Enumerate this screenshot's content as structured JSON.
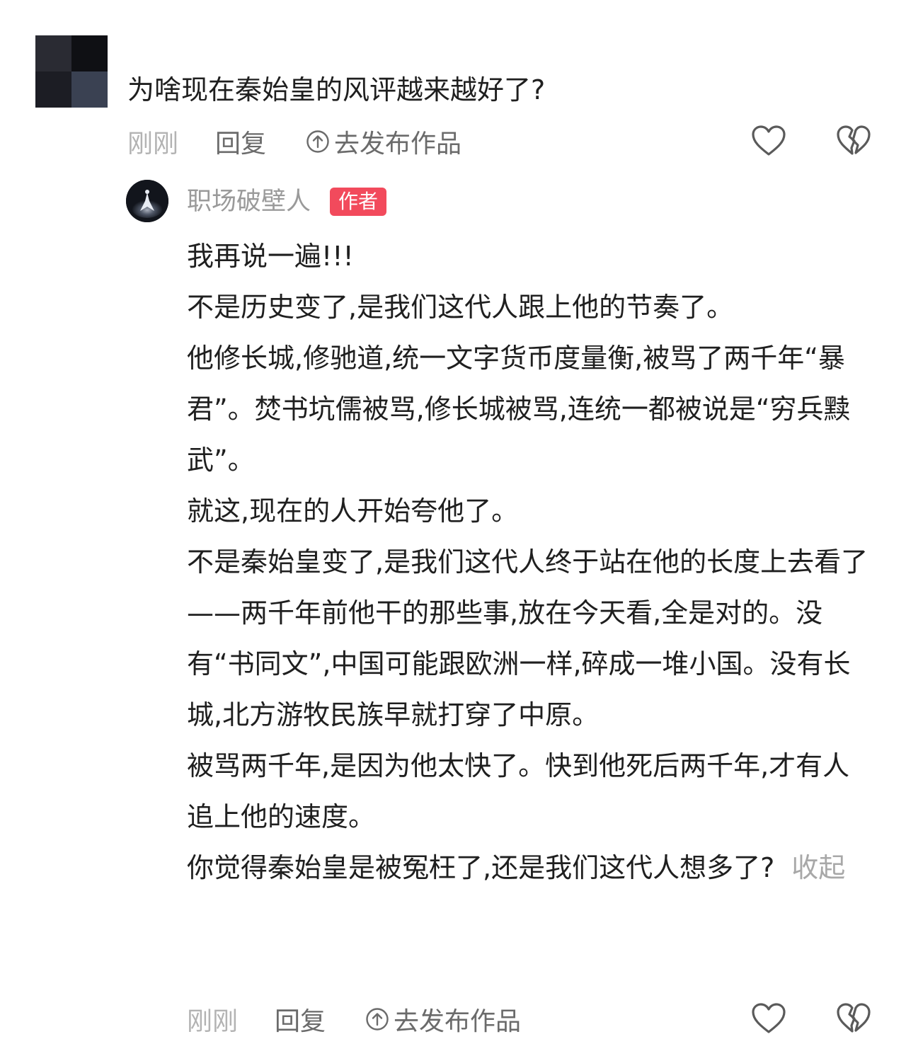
{
  "question": {
    "text": "为啥现在秦始皇的风评越来越好了?",
    "time": "刚刚",
    "reply_label": "回复",
    "publish_label": "去发布作品"
  },
  "author_reply": {
    "name": "职场破壁人",
    "badge": "作者",
    "paragraphs": [
      "我再说一遍!!!",
      "不是历史变了,是我们这代人跟上他的节奏了。",
      "他修长城,修驰道,统一文字货币度量衡,被骂了两千年“暴君”。焚书坑儒被骂,修长城被骂,连统一都被说是“穷兵黩武”。",
      "就这,现在的人开始夸他了。",
      "不是秦始皇变了,是我们这代人终于站在他的长度上去看了——两千年前他干的那些事,放在今天看,全是对的。没有“书同文”,中国可能跟欧洲一样,碎成一堆小国。没有长城,北方游牧民族早就打穿了中原。",
      "被骂两千年,是因为他太快了。快到他死后两千年,才有人追上他的速度。",
      "你觉得秦始皇是被冤枉了,还是我们这代人想多了?"
    ],
    "collapse_label": "收起",
    "time": "刚刚",
    "reply_label": "回复",
    "publish_label": "去发布作品"
  },
  "icons": {
    "like": "heart-outline-icon",
    "dislike": "broken-heart-icon",
    "publish": "upload-circle-icon"
  },
  "colors": {
    "badge": "#f24a5c",
    "muted": "#b3b3b3",
    "text": "#1f1f1f"
  }
}
